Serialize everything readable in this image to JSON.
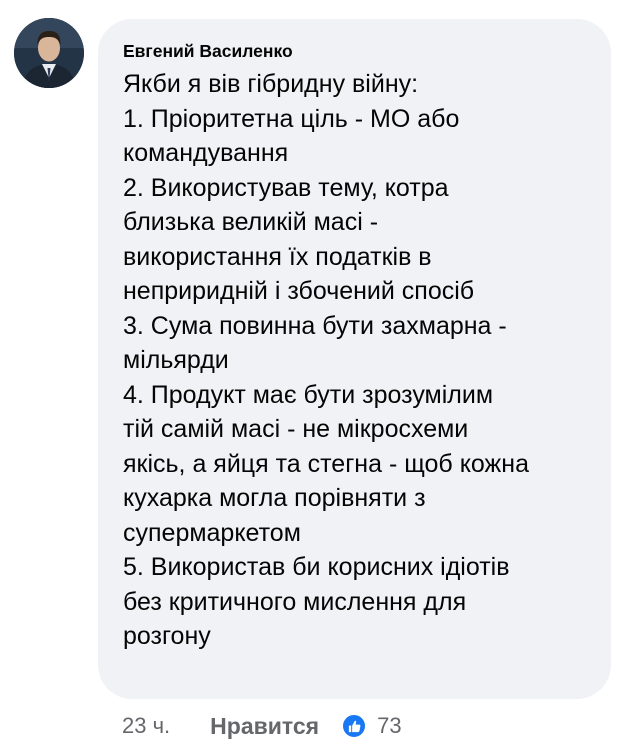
{
  "comment": {
    "author": "Евгений Василенко",
    "avatar_icon": "profile-photo",
    "lines": [
      "Якби я вів гібридну війну:",
      "1. Пріоритетна ціль - МО або",
      "командування",
      "2. Використував тему, котра",
      "близька великій масі -",
      "використання їх податків в",
      "неприридній і збочений спосіб",
      "3. Сума повинна бути захмарна -",
      "мільярди",
      "4. Продукт має бути зрозумілим",
      "тій самій масі - не мікросхеми",
      "якісь, а яйця та стегна - щоб кожна",
      "кухарка могла порівняти з",
      "супермаркетом",
      "5. Використав би корисних ідіотів",
      "без критичного мислення для",
      "розгону"
    ]
  },
  "actions": {
    "time": "23 ч.",
    "like_label": "Нравится",
    "reaction_icon": "thumbs-up-icon",
    "reaction_count": "73"
  },
  "colors": {
    "bubble_background": "#f0f2f5",
    "text": "#050505",
    "secondary_text": "#65676b",
    "like_blue": "#1877f2"
  }
}
